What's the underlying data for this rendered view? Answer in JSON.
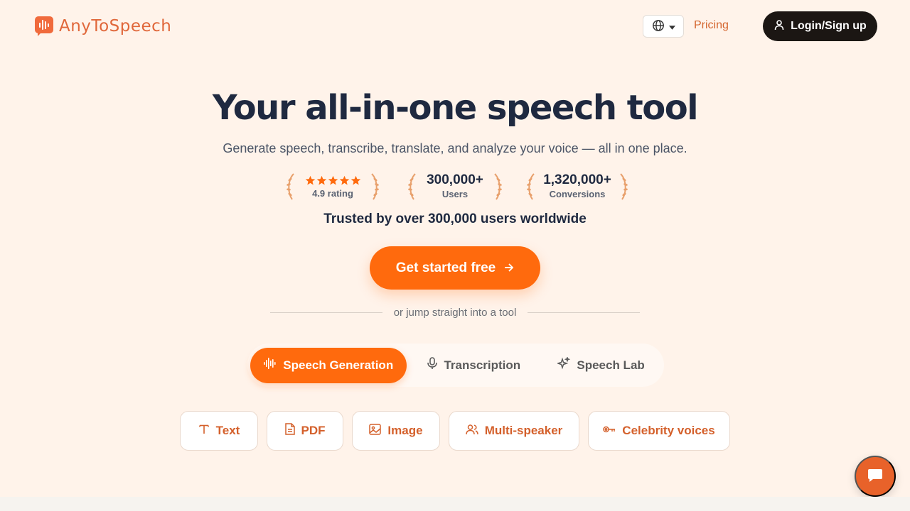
{
  "brand": {
    "name": "AnyToSpeech",
    "accent": "#ff6a0d",
    "logo_color": "#e0673a"
  },
  "header": {
    "language_icon": "globe-icon",
    "pricing_label": "Pricing",
    "login_label": "Login/Sign up"
  },
  "hero": {
    "title": "Your all-in-one speech tool",
    "subtitle": "Generate speech, transcribe, translate, and analyze your voice — all in one place.",
    "stats": [
      {
        "value": "",
        "label": "4.9 rating",
        "stars": 5
      },
      {
        "value": "300,000+",
        "label": "Users"
      },
      {
        "value": "1,320,000+",
        "label": "Conversions"
      }
    ],
    "trusted": "Trusted by over 300,000 users worldwide",
    "cta_label": "Get started free",
    "divider_text": "or jump straight into a tool"
  },
  "tabs": [
    {
      "label": "Speech Generation",
      "icon": "waveform-icon",
      "active": true
    },
    {
      "label": "Transcription",
      "icon": "microphone-icon",
      "active": false
    },
    {
      "label": "Speech Lab",
      "icon": "sparkles-icon",
      "active": false
    }
  ],
  "chips": [
    {
      "label": "Text",
      "icon": "text-icon"
    },
    {
      "label": "PDF",
      "icon": "document-icon"
    },
    {
      "label": "Image",
      "icon": "image-icon"
    },
    {
      "label": "Multi-speaker",
      "icon": "users-icon"
    },
    {
      "label": "Celebrity voices",
      "icon": "celebrity-icon"
    }
  ],
  "chat": {
    "icon": "chat-icon"
  }
}
